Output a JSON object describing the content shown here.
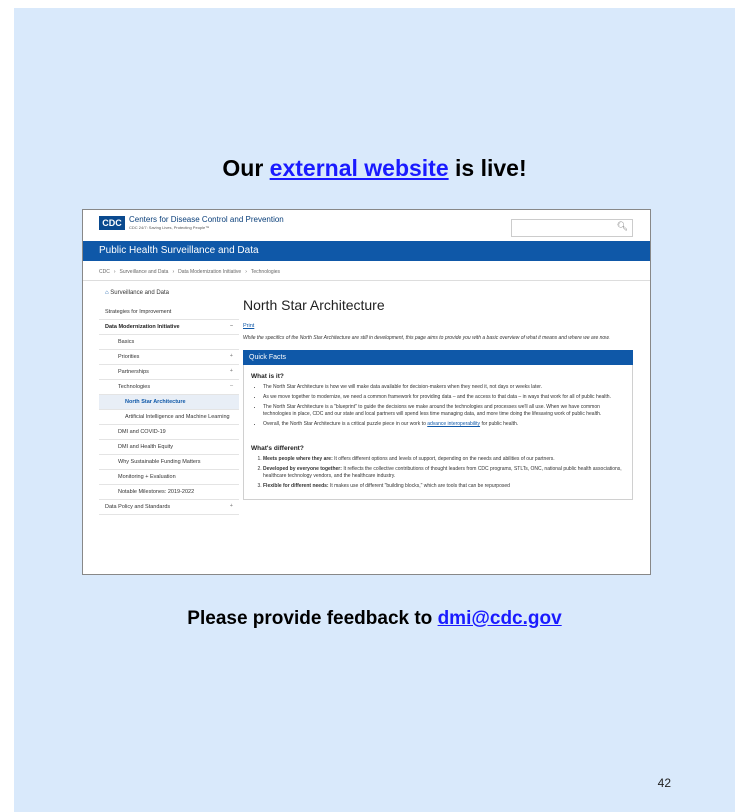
{
  "slide": {
    "title_pre": "Our",
    "title_link": "external website",
    "title_post": "is live!",
    "feedback_pre": "Please provide feedback to",
    "feedback_email": "dmi@cdc.gov",
    "page_number": "42"
  },
  "screenshot": {
    "logo": "CDC",
    "org_name": "Centers for Disease Control and Prevention",
    "tagline": "CDC 24/7: Saving Lives, Protecting People™",
    "banner": "Public Health Surveillance and Data",
    "breadcrumbs": [
      "CDC",
      "›",
      "Surveillance and Data",
      "›",
      "Data Modernization Initiative",
      "›",
      "Technologies"
    ],
    "sidebar": {
      "home": "Surveillance and Data",
      "items": [
        {
          "label": "Strategies for Improvement",
          "level": "l1",
          "arrow": ""
        },
        {
          "label": "Data Modernization Initiative",
          "level": "l1b",
          "arrow": "–"
        },
        {
          "label": "Basics",
          "level": "l2",
          "arrow": ""
        },
        {
          "label": "Priorities",
          "level": "l2",
          "arrow": "+"
        },
        {
          "label": "Partnerships",
          "level": "l2",
          "arrow": "+"
        },
        {
          "label": "Technologies",
          "level": "l2",
          "arrow": "–"
        },
        {
          "label": "North Star Architecture",
          "level": "l3 active",
          "arrow": ""
        },
        {
          "label": "Artificial Intelligence and Machine Learning",
          "level": "l3",
          "arrow": ""
        },
        {
          "label": "DMI and COVID-19",
          "level": "l2",
          "arrow": ""
        },
        {
          "label": "DMI and Health Equity",
          "level": "l2",
          "arrow": ""
        },
        {
          "label": "Why Sustainable Funding Matters",
          "level": "l2",
          "arrow": ""
        },
        {
          "label": "Monitoring + Evaluation",
          "level": "l2",
          "arrow": ""
        },
        {
          "label": "Notable Milestones: 2019-2022",
          "level": "l2",
          "arrow": ""
        },
        {
          "label": "Data Policy and Standards",
          "level": "l1",
          "arrow": "+"
        }
      ]
    },
    "main": {
      "heading": "North Star Architecture",
      "print": "Print",
      "intro": "While the specifics of the North Star Architecture are still in development, this page aims to provide you with a basic overview of what it means and where we are now.",
      "quick_facts": "Quick Facts",
      "what_is_it": "What is it?",
      "bullets": [
        "The North Star Architecture is how we will make data available for decision-makers when they need it, not days or weeks later.",
        "As we move together to modernize, we need a common framework for providing data – and the access to that data – in ways that work for all of public health.",
        "The North Star Architecture is a \"blueprint\" to guide the decisions we make around the technologies and processes we'll all use. When we have common technologies in place, CDC and our state and local partners will spend less time managing data, and more time doing the lifesaving work of public health."
      ],
      "bullet4_pre": "Overall, the North Star Architecture is a critical puzzle piece in our work to",
      "bullet4_link": "advance interoperability",
      "bullet4_post": "for public health.",
      "whats_different": "What's different?",
      "numbered": [
        {
          "bold": "Meets people where they are:",
          "text": "It offers different options and levels of support, depending on the needs and abilities of our partners."
        },
        {
          "bold": "Developed by everyone together:",
          "text": "It reflects the collective contributions of thought leaders from CDC programs, STLTs, ONC, national public health associations, healthcare technology vendors, and the healthcare industry."
        },
        {
          "bold": "Flexible for different needs:",
          "text": "It makes use of different \"building blocks,\" which are tools that can be repurposed"
        }
      ]
    }
  }
}
